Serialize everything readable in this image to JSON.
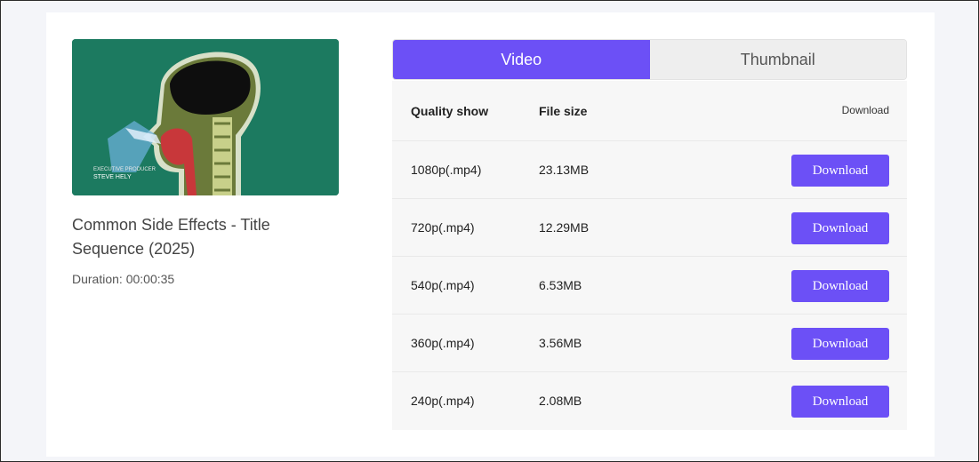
{
  "video": {
    "title": "Common Side Effects - Title Sequence (2025)",
    "duration_label": "Duration:",
    "duration_value": "00:00:35",
    "thumbnail_caption_line1": "EXECUTIVE PRODUCER",
    "thumbnail_caption_line2": "STEVE HELY"
  },
  "tabs": [
    {
      "label": "Video",
      "active": true
    },
    {
      "label": "Thumbnail",
      "active": false
    }
  ],
  "table": {
    "headers": {
      "quality": "Quality show",
      "size": "File size",
      "download": "Download"
    },
    "rows": [
      {
        "quality": "1080p(.mp4)",
        "size": "23.13MB",
        "button": "Download"
      },
      {
        "quality": "720p(.mp4)",
        "size": "12.29MB",
        "button": "Download"
      },
      {
        "quality": "540p(.mp4)",
        "size": "6.53MB",
        "button": "Download"
      },
      {
        "quality": "360p(.mp4)",
        "size": "3.56MB",
        "button": "Download"
      },
      {
        "quality": "240p(.mp4)",
        "size": "2.08MB",
        "button": "Download"
      }
    ]
  },
  "colors": {
    "accent": "#6c50f6",
    "thumbnail_bg": "#1c7a60",
    "page_bg": "#f4f5f9"
  }
}
